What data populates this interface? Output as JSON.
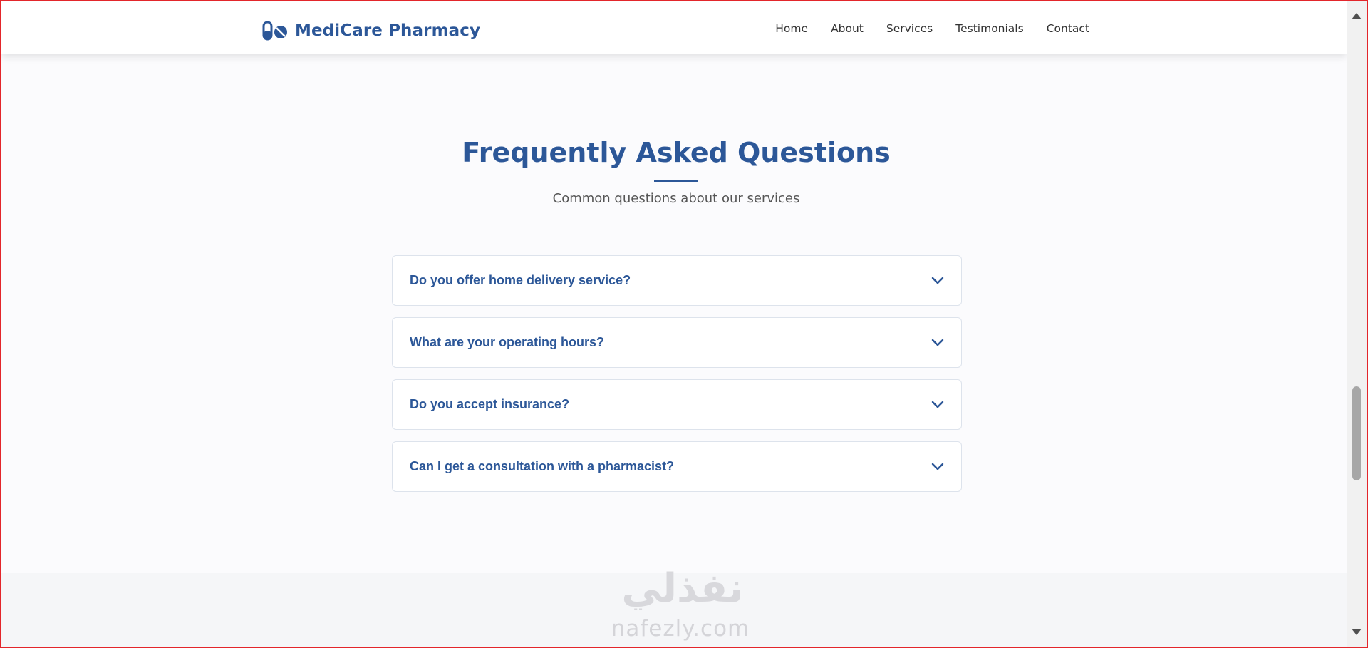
{
  "nav": {
    "brand": "MediCare Pharmacy",
    "brand_icon": "pills-icon",
    "links": [
      "Home",
      "About",
      "Services",
      "Testimonials",
      "Contact"
    ]
  },
  "faq": {
    "title": "Frequently Asked Questions",
    "subtitle": "Common questions about our services",
    "items": [
      {
        "question": "Do you offer home delivery service?",
        "icon": "chevron-down-icon"
      },
      {
        "question": "What are your operating hours?",
        "icon": "chevron-down-icon"
      },
      {
        "question": "Do you accept insurance?",
        "icon": "chevron-down-icon"
      },
      {
        "question": "Can I get a consultation with a pharmacist?",
        "icon": "chevron-down-icon"
      }
    ]
  },
  "watermark": {
    "arabic": "نفذلي",
    "latin": "nafezly.com"
  },
  "colors": {
    "brand": "#2c5798",
    "nav_text": "#333333",
    "subtitle": "#555555",
    "frame": "#e3262b"
  }
}
